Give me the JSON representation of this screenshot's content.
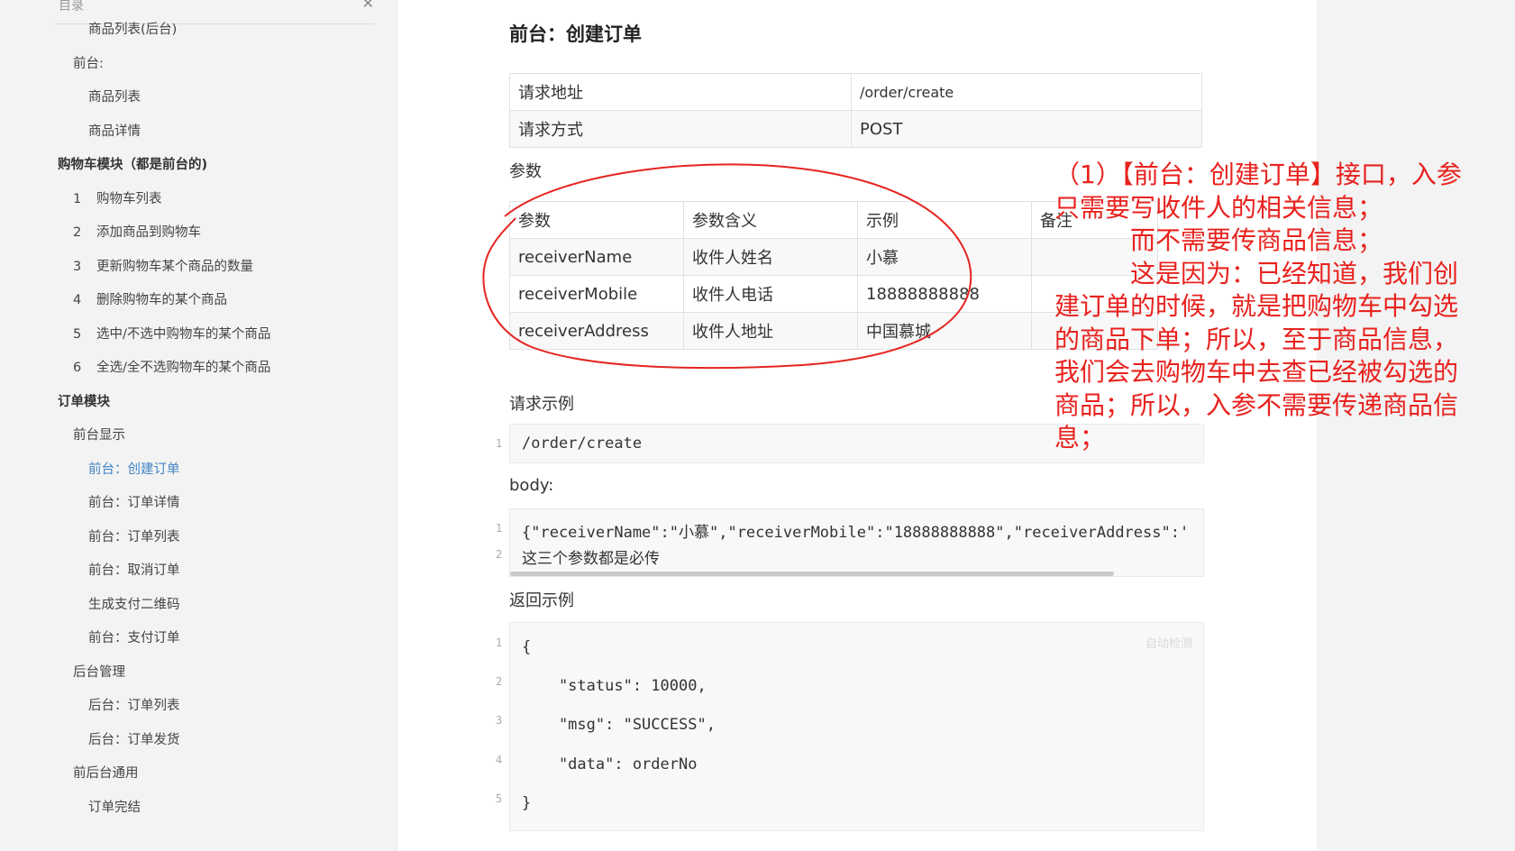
{
  "sidebar": {
    "title": "目录",
    "items": [
      {
        "text": "商品列表(后台)",
        "level": 3
      },
      {
        "text": "前台:",
        "level": 2
      },
      {
        "text": "商品列表",
        "level": 3
      },
      {
        "text": "商品详情",
        "level": 3
      },
      {
        "text": "购物车模块（都是前台的)",
        "level": 1
      },
      {
        "num": "1",
        "text": "购物车列表",
        "level": 2
      },
      {
        "num": "2",
        "text": "添加商品到购物车",
        "level": 2
      },
      {
        "num": "3",
        "text": "更新购物车某个商品的数量",
        "level": 2
      },
      {
        "num": "4",
        "text": "删除购物车的某个商品",
        "level": 2
      },
      {
        "num": "5",
        "text": "选中/不选中购物车的某个商品",
        "level": 2
      },
      {
        "num": "6",
        "text": "全选/全不选购物车的某个商品",
        "level": 2
      },
      {
        "text": "订单模块",
        "level": 1
      },
      {
        "text": "前台显示",
        "level": 2
      },
      {
        "text": "前台：创建订单",
        "level": 3,
        "active": true
      },
      {
        "text": "前台：订单详情",
        "level": 3
      },
      {
        "text": "前台：订单列表",
        "level": 3
      },
      {
        "text": "前台：取消订单",
        "level": 3
      },
      {
        "text": "生成支付二维码",
        "level": 3
      },
      {
        "text": "前台：支付订单",
        "level": 3
      },
      {
        "text": "后台管理",
        "level": 2
      },
      {
        "text": "后台：订单列表",
        "level": 3
      },
      {
        "text": "后台：订单发货",
        "level": 3
      },
      {
        "text": "前后台通用",
        "level": 2
      },
      {
        "text": "订单完结",
        "level": 3
      }
    ]
  },
  "main": {
    "title": "前台：创建订单",
    "request_table": [
      [
        "请求地址",
        "/order/create"
      ],
      [
        "请求方式",
        "POST"
      ]
    ],
    "params_label": "参数",
    "params_headers": [
      "参数",
      "参数含义",
      "示例",
      "备注"
    ],
    "params_rows": [
      [
        "receiverName",
        "收件人姓名",
        "小慕",
        ""
      ],
      [
        "receiverMobile",
        "收件人电话",
        "18888888888",
        ""
      ],
      [
        "receiverAddress",
        "收件人地址",
        "中国慕城",
        ""
      ]
    ],
    "request_example_label": "请求示例",
    "request_example_code": "/order/create",
    "body_label": "body:",
    "body_code": [
      "{\"receiverName\":\"小慕\",\"receiverMobile\":\"18888888888\",\"receiverAddress\":'",
      "这三个参数都是必传"
    ],
    "return_example_label": "返回示例",
    "auto_detect": "自动检测",
    "return_code": [
      "{",
      "    \"status\": 10000,",
      "    \"msg\": \"SUCCESS\",",
      "    \"data\": orderNo",
      "}"
    ]
  },
  "annotation": {
    "color": "#e8221e",
    "lines": [
      "（1）【前台：创建订单】接口，入参",
      "只需要写收件人的相关信息；",
      "　　　而不需要传商品信息；",
      "　　　这是因为：已经知道，我们创",
      "建订单的时候，就是把购物车中勾选",
      "的商品下单；所以，至于商品信息，",
      "我们会去购物车中去查已经被勾选的",
      "商品；所以，入参不需要传递商品信",
      "息；"
    ]
  }
}
